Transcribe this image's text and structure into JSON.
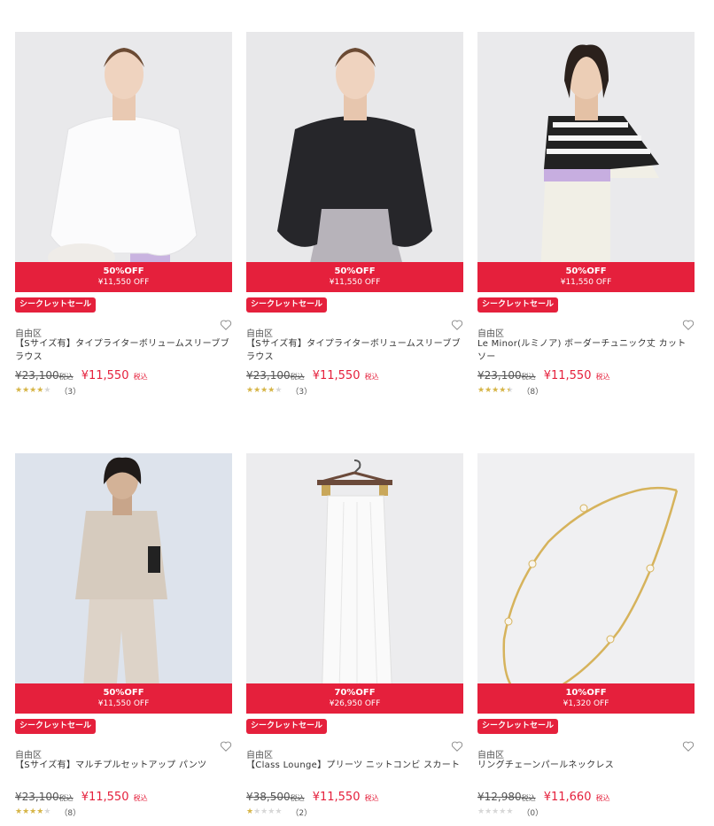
{
  "colors": {
    "sale_red": "#e5203c",
    "star_gold": "#d6b547",
    "star_grey": "#d7d7d7"
  },
  "products": [
    {
      "discount_pct": "50%OFF",
      "discount_amount": "¥11,550 OFF",
      "badge": "シークレットセール",
      "brand": "自由区",
      "name": "【Sサイズ有】タイプライターボリュームスリーブブラウス",
      "old_price": "¥23,100",
      "old_tax": "税込",
      "new_price": "¥11,550",
      "new_tax": "税込",
      "rating": 4,
      "review_count": "（3）",
      "icon": "heart-icon"
    },
    {
      "discount_pct": "50%OFF",
      "discount_amount": "¥11,550 OFF",
      "badge": "シークレットセール",
      "brand": "自由区",
      "name": "【Sサイズ有】タイプライターボリュームスリーブブラウス",
      "old_price": "¥23,100",
      "old_tax": "税込",
      "new_price": "¥11,550",
      "new_tax": "税込",
      "rating": 4,
      "review_count": "（3）",
      "icon": "heart-icon"
    },
    {
      "discount_pct": "50%OFF",
      "discount_amount": "¥11,550 OFF",
      "badge": "シークレットセール",
      "brand": "自由区",
      "name": "Le Minor(ルミノア) ボーダーチュニック丈 カットソー",
      "old_price": "¥23,100",
      "old_tax": "税込",
      "new_price": "¥11,550",
      "new_tax": "税込",
      "rating": 4.5,
      "review_count": "（8）",
      "icon": "heart-icon"
    },
    {
      "discount_pct": "50%OFF",
      "discount_amount": "¥11,550 OFF",
      "badge": "シークレットセール",
      "brand": "自由区",
      "name": "【Sサイズ有】マルチプルセットアップ パンツ",
      "old_price": "¥23,100",
      "old_tax": "税込",
      "new_price": "¥11,550",
      "new_tax": "税込",
      "rating": 4,
      "review_count": "（8）",
      "icon": "heart-icon"
    },
    {
      "discount_pct": "70%OFF",
      "discount_amount": "¥26,950 OFF",
      "badge": "シークレットセール",
      "brand": "自由区",
      "name": "【Class Lounge】プリーツ ニットコンビ スカート",
      "old_price": "¥38,500",
      "old_tax": "税込",
      "new_price": "¥11,550",
      "new_tax": "税込",
      "rating": 1,
      "review_count": "（2）",
      "icon": "heart-icon"
    },
    {
      "discount_pct": "10%OFF",
      "discount_amount": "¥1,320 OFF",
      "badge": "シークレットセール",
      "brand": "自由区",
      "name": "リングチェーンパールネックレス",
      "old_price": "¥12,980",
      "old_tax": "税込",
      "new_price": "¥11,660",
      "new_tax": "税込",
      "rating": 0,
      "review_count": "（0）",
      "icon": "heart-icon"
    }
  ]
}
